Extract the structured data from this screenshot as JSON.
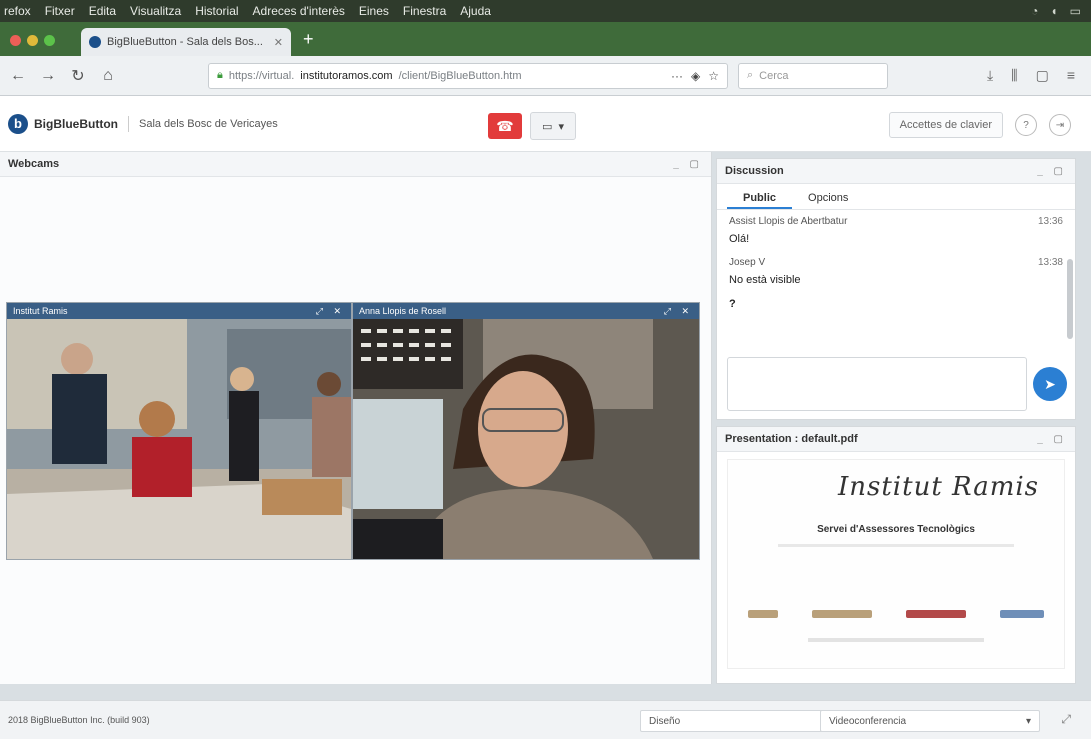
{
  "os_menu": [
    "refox",
    "Fitxer",
    "Edita",
    "Visualitza",
    "Historial",
    "Adreces d'interès",
    "Eines",
    "Finestra",
    "Ajuda"
  ],
  "tab": {
    "title": "BigBlueButton - Sala dels Bos...",
    "close": "✕",
    "new": "+"
  },
  "nav": {
    "url_prefix": "https://virtual.",
    "url_host": "institutoramos.com",
    "url_rest": "/client/BigBlueButton.htm",
    "search_placeholder": "Cerca",
    "more": "···"
  },
  "app": {
    "brand": "BigBlueButton",
    "room": "Sala dels Bosc de Vericayes",
    "shortcuts_label": "Accettes de clavier"
  },
  "webcams": {
    "title": "Webcams",
    "video1_label": "Institut Ramis",
    "video2_label": "Anna Llopis de Rosell"
  },
  "chat": {
    "title": "Discussion",
    "tab_public": "Public",
    "tab_options": "Opcions",
    "messages": [
      {
        "who": "Assist Llopis de Abertbatur",
        "time": "13:36",
        "text": "Olá!"
      },
      {
        "who": "Josep V",
        "time": "13:38",
        "text": "No està visible"
      },
      {
        "who": "",
        "time": "",
        "text": "?"
      }
    ]
  },
  "presentation": {
    "title": "Presentation : default.pdf",
    "signature": "Institut Ramis",
    "service": "Servei d'Assessores Tecnològics"
  },
  "footer": {
    "copyright": "2018 BigBlueButton Inc. (build 903)",
    "layout_select": "Diseño",
    "mode_select": "Videoconferencia"
  },
  "colors": {
    "hangup": "#e23b3b",
    "accent": "#2b7fd3",
    "browser_tabbar": "#3f6b3a"
  }
}
